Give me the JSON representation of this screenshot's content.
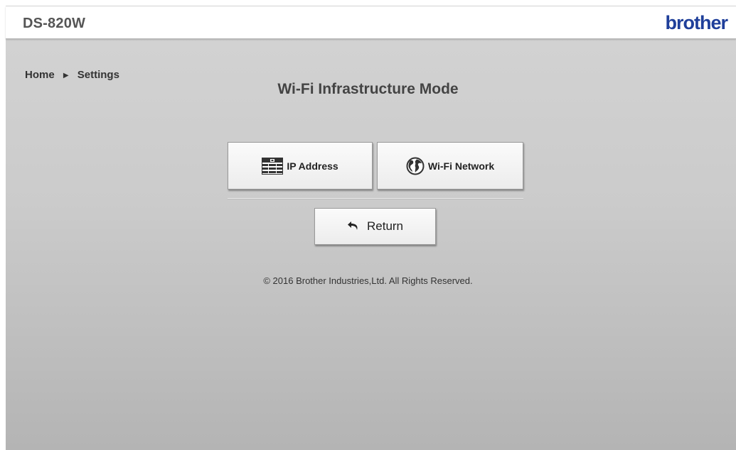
{
  "header": {
    "model": "DS-820W",
    "logo": "brother"
  },
  "breadcrumb": {
    "home": "Home",
    "current": "Settings"
  },
  "page": {
    "title": "Wi-Fi Infrastructure Mode"
  },
  "buttons": {
    "ip_address": "IP Address",
    "wifi_network": "Wi-Fi Network",
    "return": "Return"
  },
  "icons": {
    "ip_address": "ip-address-icon",
    "wifi_network": "globe-icon",
    "return": "return-arrow-icon",
    "breadcrumb_separator": "triangle-right-icon"
  },
  "footer": {
    "copyright": "© 2016 Brother Industries,Ltd. All Rights Reserved."
  },
  "colors": {
    "logo": "#1f3f9a",
    "background_top": "#d2d2d2",
    "background_bottom": "#b4b4b4"
  }
}
